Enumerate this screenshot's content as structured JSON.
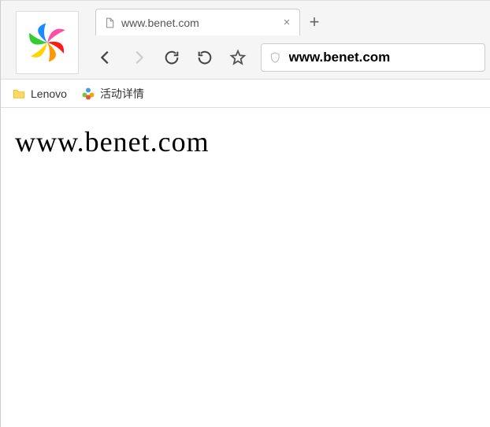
{
  "tab": {
    "title": "www.benet.com"
  },
  "url_bar": {
    "value": "www.benet.com"
  },
  "bookmarks": {
    "item0": "Lenovo",
    "item1": "活动详情"
  },
  "page": {
    "heading": "www.benet.com"
  }
}
